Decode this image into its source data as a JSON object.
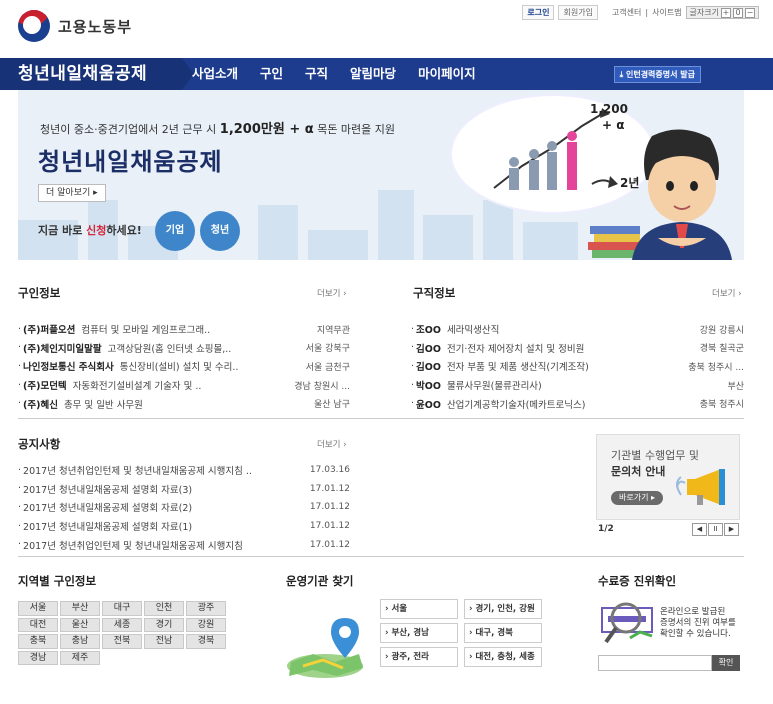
{
  "header": {
    "logo_text": "고용노동부",
    "login": "로그인",
    "join": "회원가입",
    "customer_center": "고객센터",
    "sitemap": "사이트맵",
    "font_size_label": "글자크기",
    "zoom_in": "+",
    "zoom_reset": "0",
    "zoom_out": "−"
  },
  "nav": {
    "brand": "청년내일채움공제",
    "items": [
      "사업소개",
      "구인",
      "구직",
      "알림마당",
      "마이페이지"
    ],
    "certificate_button": "인턴경력증명서 발급"
  },
  "banner": {
    "subtitle_prefix": "청년이 중소·중견기업에서 2년 근무 시 ",
    "subtitle_amount": "1,200만원 + α",
    "subtitle_suffix": " 목돈 마련을 지원",
    "title": "청년내일채움공제",
    "more_button": "더 알아보기 ▸",
    "apply_prefix": "지금 바로 ",
    "apply_highlight": "신청",
    "apply_suffix": "하세요!",
    "btn_company": "기업",
    "btn_youth": "청년",
    "bubble_amount": "1,200",
    "bubble_alpha": "+ α",
    "bubble_years": "2년"
  },
  "job_offers": {
    "title": "구인정보",
    "more": "더보기 ›",
    "items": [
      {
        "company": "(주)퍼플오션",
        "desc": "컴퓨터 및 모바일 게임프로그래..",
        "loc": "지역무관"
      },
      {
        "company": "(주)체인지미일말팔",
        "desc": "고객상담원(홈 인터넷 쇼핑몰,..",
        "loc": "서울 강북구"
      },
      {
        "company": "나인정보통신 주식회사",
        "desc": "통신장비(설비) 설치 및 수리..",
        "loc": "서울 금천구"
      },
      {
        "company": "(주)모던텍",
        "desc": "자동화전기설비설계 기술자 및 ..",
        "loc": "경남 창원시 ..."
      },
      {
        "company": "(주)혜신",
        "desc": "총무 및 일반 사무원",
        "loc": "울산 남구"
      }
    ]
  },
  "job_seekers": {
    "title": "구직정보",
    "more": "더보기 ›",
    "items": [
      {
        "name": "조OO",
        "desc": "세라믹생산직",
        "loc": "강원 강릉시"
      },
      {
        "name": "김OO",
        "desc": "전기·전자 제어장치 설치 및 정비원",
        "loc": "경북 칠곡군"
      },
      {
        "name": "김OO",
        "desc": "전자 부품 및 제품 생산직(기계조작)",
        "loc": "충북 청주시 ..."
      },
      {
        "name": "박OO",
        "desc": "물류사무원(물류관리사)",
        "loc": "부산"
      },
      {
        "name": "윤OO",
        "desc": "산업기계공학기술자(메카트로닉스)",
        "loc": "충북 청주시"
      }
    ]
  },
  "notices": {
    "title": "공지사항",
    "more": "더보기 ›",
    "items": [
      {
        "text": "2017년 청년취업인턴제 및 청년내일채움공제 시행지침 ..",
        "date": "17.03.16"
      },
      {
        "text": "2017년 청년내일채움공제 설명회 자료(3)",
        "date": "17.01.12"
      },
      {
        "text": "2017년 청년내일채움공제 설명회 자료(2)",
        "date": "17.01.12"
      },
      {
        "text": "2017년 청년내일채움공제 설명회 자료(1)",
        "date": "17.01.12"
      },
      {
        "text": "2017년 청년취업인턴제 및 청년내일채움공제 시행지침",
        "date": "17.01.12"
      }
    ]
  },
  "side_banner": {
    "line1": "기관별 수행업무 및",
    "line2": "문의처 안내",
    "button": "바로가기 ▸",
    "pager": "1/2",
    "prev": "◀",
    "pause": "II",
    "next": "▶"
  },
  "region": {
    "title": "지역별 구인정보",
    "items": [
      "서울",
      "부산",
      "대구",
      "인천",
      "광주",
      "대전",
      "울산",
      "세종",
      "경기",
      "강원",
      "충북",
      "충남",
      "전북",
      "전남",
      "경북",
      "경남",
      "제주"
    ]
  },
  "agency": {
    "title": "운영기관 찾기",
    "items": [
      "› 서울",
      "› 경기, 인천, 강원",
      "› 부산, 경남",
      "› 대구, 경북",
      "› 광주, 전라",
      "› 대전, 충청, 세종"
    ]
  },
  "certificate": {
    "title": "수료증 진위확인",
    "line1": "온라인으로 발급된",
    "line2": "증명서의 진위 여부를",
    "line3": "확인할 수 있습니다.",
    "button": "확인"
  },
  "colors": {
    "nav_bg": "#1d3c8e",
    "brand_bg": "#173276",
    "accent_blue": "#3e86c9",
    "highlight_red": "#d4263a"
  }
}
